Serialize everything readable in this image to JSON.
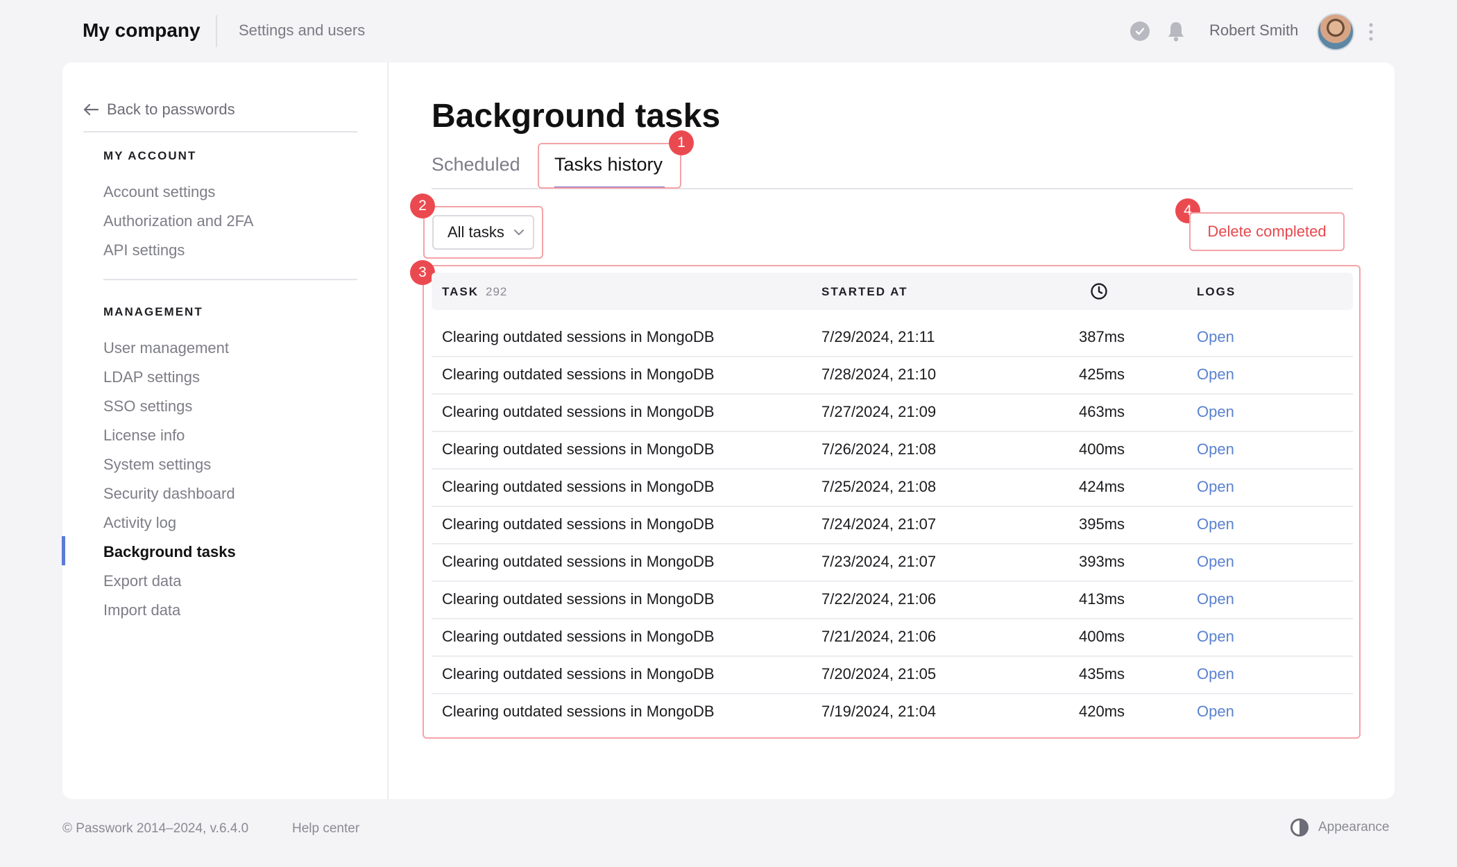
{
  "header": {
    "brand": "My company",
    "section": "Settings and users",
    "username": "Robert Smith",
    "icons": [
      "check-circle-icon",
      "bell-icon",
      "avatar",
      "kebab-icon"
    ]
  },
  "sidebar": {
    "back_label": "Back to passwords",
    "account_heading": "MY ACCOUNT",
    "account_items": [
      {
        "label": "Account settings"
      },
      {
        "label": "Authorization and 2FA"
      },
      {
        "label": "API settings"
      }
    ],
    "management_heading": "MANAGEMENT",
    "management_items": [
      {
        "label": "User management"
      },
      {
        "label": "LDAP settings"
      },
      {
        "label": "SSO settings"
      },
      {
        "label": "License info"
      },
      {
        "label": "System settings"
      },
      {
        "label": "Security dashboard"
      },
      {
        "label": "Activity log"
      },
      {
        "label": "Background tasks",
        "active": true
      },
      {
        "label": "Export data"
      },
      {
        "label": "Import data"
      }
    ]
  },
  "main": {
    "title": "Background tasks",
    "tabs": [
      {
        "label": "Scheduled",
        "active": false
      },
      {
        "label": "Tasks history",
        "active": true
      }
    ],
    "filter": {
      "selected": "All tasks"
    },
    "delete_label": "Delete completed",
    "callouts": [
      "1",
      "2",
      "3",
      "4"
    ],
    "table": {
      "headers": {
        "task": "TASK",
        "count": "292",
        "started": "STARTED AT",
        "logs": "LOGS"
      },
      "rows": [
        {
          "task": "Clearing outdated sessions in MongoDB",
          "started": "7/29/2024, 21:11",
          "duration": "387ms",
          "logs": "Open"
        },
        {
          "task": "Clearing outdated sessions in MongoDB",
          "started": "7/28/2024, 21:10",
          "duration": "425ms",
          "logs": "Open"
        },
        {
          "task": "Clearing outdated sessions in MongoDB",
          "started": "7/27/2024, 21:09",
          "duration": "463ms",
          "logs": "Open"
        },
        {
          "task": "Clearing outdated sessions in MongoDB",
          "started": "7/26/2024, 21:08",
          "duration": "400ms",
          "logs": "Open"
        },
        {
          "task": "Clearing outdated sessions in MongoDB",
          "started": "7/25/2024, 21:08",
          "duration": "424ms",
          "logs": "Open"
        },
        {
          "task": "Clearing outdated sessions in MongoDB",
          "started": "7/24/2024, 21:07",
          "duration": "395ms",
          "logs": "Open"
        },
        {
          "task": "Clearing outdated sessions in MongoDB",
          "started": "7/23/2024, 21:07",
          "duration": "393ms",
          "logs": "Open"
        },
        {
          "task": "Clearing outdated sessions in MongoDB",
          "started": "7/22/2024, 21:06",
          "duration": "413ms",
          "logs": "Open"
        },
        {
          "task": "Clearing outdated sessions in MongoDB",
          "started": "7/21/2024, 21:06",
          "duration": "400ms",
          "logs": "Open"
        },
        {
          "task": "Clearing outdated sessions in MongoDB",
          "started": "7/20/2024, 21:05",
          "duration": "435ms",
          "logs": "Open"
        },
        {
          "task": "Clearing outdated sessions in MongoDB",
          "started": "7/19/2024, 21:04",
          "duration": "420ms",
          "logs": "Open"
        }
      ]
    }
  },
  "footer": {
    "copyright": "© Passwork 2014–2024, v.6.4.0",
    "help": "Help center",
    "appearance": "Appearance"
  },
  "colors": {
    "accent": "#5b7bd5",
    "tab_underline": "#7b5ec2",
    "link": "#5a82cf",
    "danger": "#e5484d",
    "callout": "#ea4a4f"
  }
}
